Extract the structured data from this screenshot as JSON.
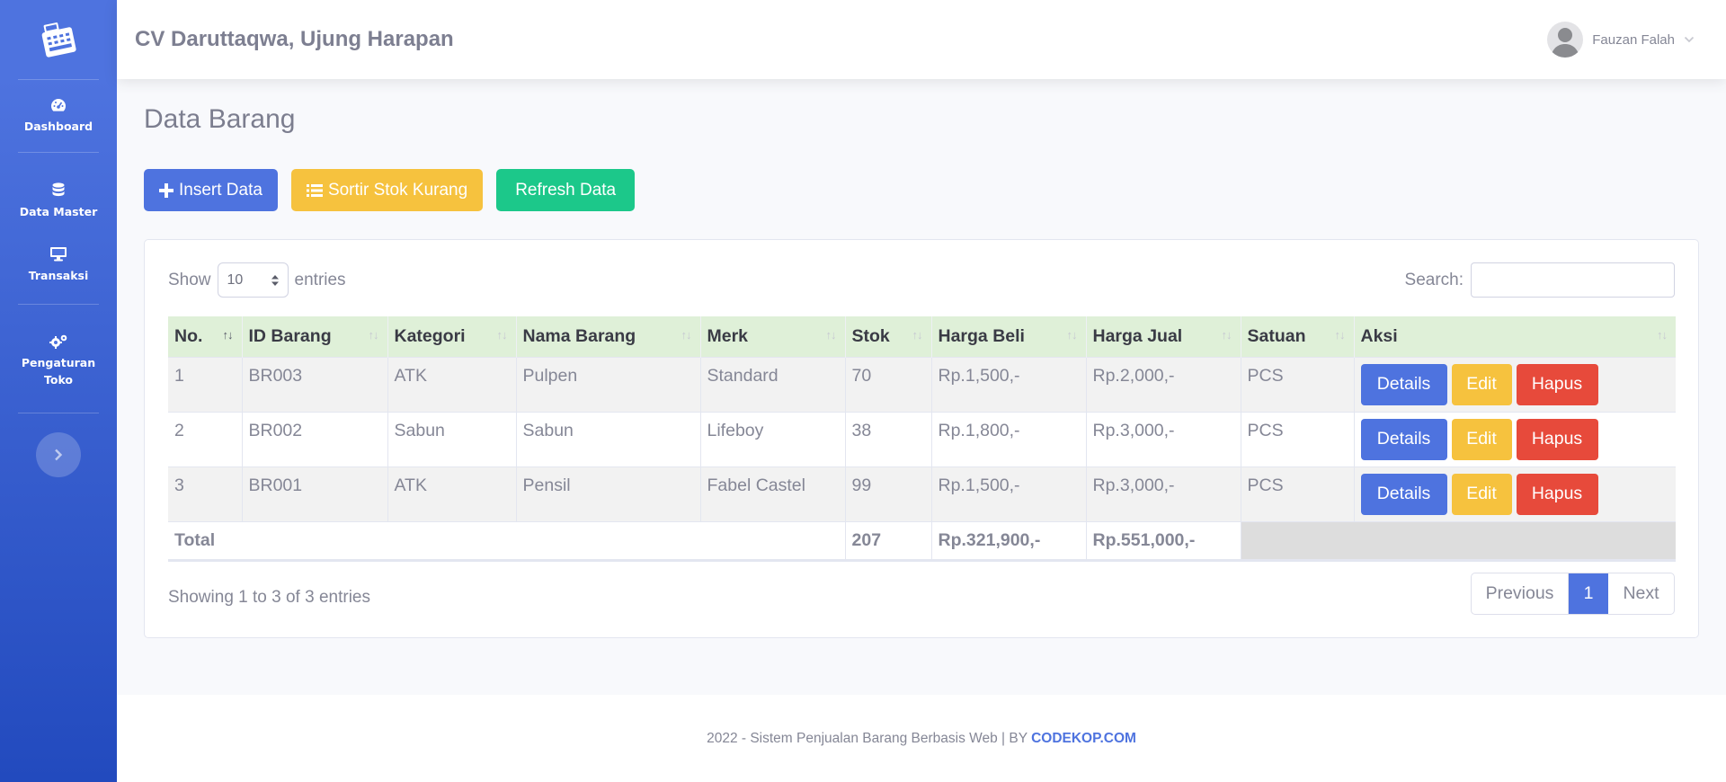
{
  "sidebar": {
    "items": [
      {
        "label": "Dashboard",
        "icon": "tachometer-icon"
      },
      {
        "label": "Data Master",
        "icon": "database-icon"
      },
      {
        "label": "Transaksi",
        "icon": "desktop-icon"
      },
      {
        "label": "Pengaturan Toko",
        "icon": "cogs-icon"
      }
    ]
  },
  "topbar": {
    "store_name": "CV Daruttaqwa, Ujung Harapan",
    "user_name": "Fauzan Falah"
  },
  "page": {
    "title": "Data Barang",
    "buttons": {
      "insert": "Insert Data",
      "sort": "Sortir Stok Kurang",
      "refresh": "Refresh Data"
    }
  },
  "table_controls": {
    "show_label": "Show",
    "entries_value": "10",
    "entries_label": "entries",
    "search_label": "Search:",
    "search_value": ""
  },
  "table": {
    "columns": [
      "No.",
      "ID Barang",
      "Kategori",
      "Nama Barang",
      "Merk",
      "Stok",
      "Harga Beli",
      "Harga Jual",
      "Satuan",
      "Aksi"
    ],
    "rows": [
      {
        "no": "1",
        "id": "BR003",
        "kategori": "ATK",
        "nama": "Pulpen",
        "merk": "Standard",
        "stok": "70",
        "beli": "Rp.1,500,-",
        "jual": "Rp.2,000,-",
        "satuan": "PCS"
      },
      {
        "no": "2",
        "id": "BR002",
        "kategori": "Sabun",
        "nama": "Sabun",
        "merk": "Lifeboy",
        "stok": "38",
        "beli": "Rp.1,800,-",
        "jual": "Rp.3,000,-",
        "satuan": "PCS"
      },
      {
        "no": "3",
        "id": "BR001",
        "kategori": "ATK",
        "nama": "Pensil",
        "merk": "Fabel Castel",
        "stok": "99",
        "beli": "Rp.1,500,-",
        "jual": "Rp.3,000,-",
        "satuan": "PCS"
      }
    ],
    "actions": {
      "details": "Details",
      "edit": "Edit",
      "hapus": "Hapus"
    },
    "total": {
      "label": "Total",
      "stok": "207",
      "beli": "Rp.321,900,-",
      "jual": "Rp.551,000,-"
    }
  },
  "pagination": {
    "info": "Showing 1 to 3 of 3 entries",
    "previous": "Previous",
    "current": "1",
    "next": "Next"
  },
  "footer": {
    "text": "2022 - Sistem Penjualan Barang Berbasis Web | BY",
    "link": "CODEKOP.COM"
  },
  "colors": {
    "primary": "#4e73df",
    "warning": "#f6c23e",
    "success": "#1cc88a",
    "danger": "#e74a3b",
    "header_row": "#dff0d8"
  }
}
